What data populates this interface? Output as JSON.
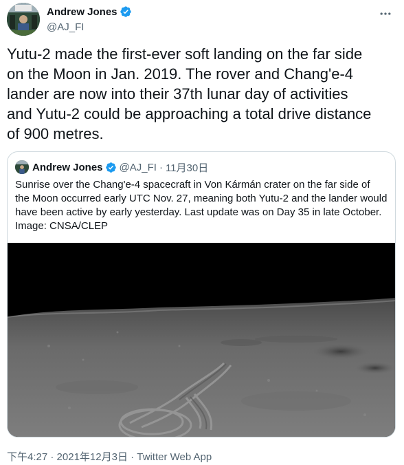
{
  "tweet": {
    "author_name": "Andrew Jones",
    "author_handle": "@AJ_FI",
    "verified_icon": "verified-badge-icon",
    "text": "Yutu-2 made the first-ever soft landing on the far side\non the Moon in Jan. 2019. The rover and Chang'e-4\nlander are now into their 37th lunar day of activities\nand Yutu-2 could be approaching a total drive distance\nof 900 metres.",
    "time": "下午4:27",
    "date": "2021年12月3日",
    "source": "Twitter Web App",
    "separator": "·"
  },
  "quote": {
    "author_name": "Andrew Jones",
    "author_handle": "@AJ_FI",
    "separator": "·",
    "date": "11月30日",
    "text": "Sunrise over the Chang'e-4 spacecraft in Von Kármán crater on the far side of\nthe Moon occurred early UTC Nov. 27, meaning both Yutu-2 and the lander would\nhave been active by early yesterday. Last update was on Day 35 in late October.\nImage: CNSA/CLEP",
    "media": "lunar-surface-photo"
  },
  "colors": {
    "text_primary": "#0f1419",
    "text_secondary": "#536471",
    "verified_blue": "#1d9bf0",
    "border": "#cfd9de"
  }
}
